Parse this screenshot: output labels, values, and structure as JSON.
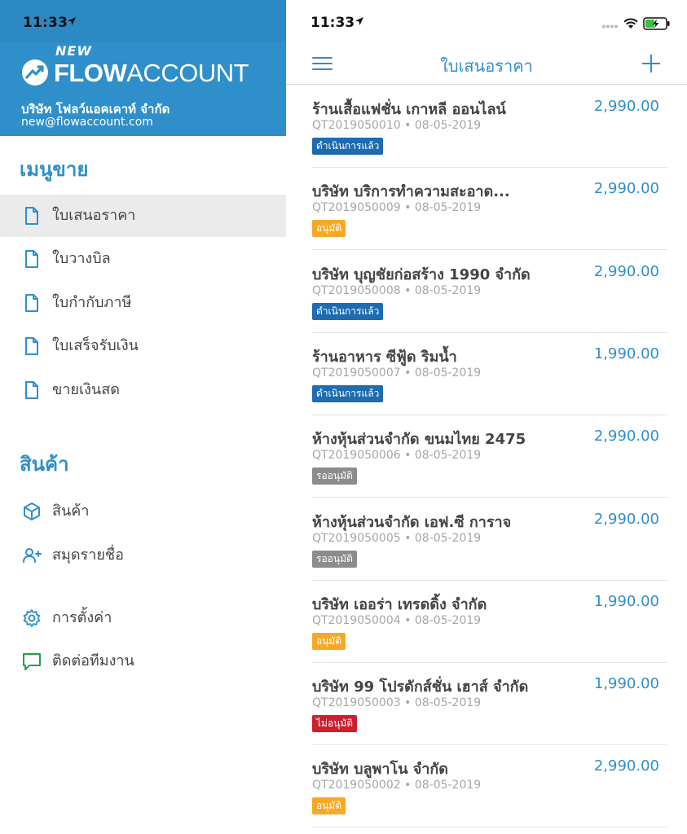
{
  "colors": {
    "brand": "#2f8fca",
    "badge_blue": "#1d6bb0",
    "badge_orange": "#f7a825",
    "badge_gray": "#8c8c8c",
    "badge_red": "#cc1f2f"
  },
  "status_bar": {
    "time_left": "11:33",
    "time_right": "11:33"
  },
  "brand": {
    "logo_new": "NEW",
    "logo_flow": "FLOW",
    "logo_account": "ACCOUNT",
    "company_name": "บริษัท โฟลว์แอคเคาท์ จำกัด",
    "company_email": "new@flowaccount.com"
  },
  "sidebar": {
    "sales_heading": "เมนูขาย",
    "sales_items": [
      {
        "label": "ใบเสนอราคา",
        "icon": "document-icon",
        "active": true
      },
      {
        "label": "ใบวางบิล",
        "icon": "document-icon",
        "active": false
      },
      {
        "label": "ใบกำกับภาษี",
        "icon": "document-icon",
        "active": false
      },
      {
        "label": "ใบเสร็จรับเงิน",
        "icon": "document-icon",
        "active": false
      },
      {
        "label": "ขายเงินสด",
        "icon": "document-icon",
        "active": false
      }
    ],
    "products_heading": "สินค้า",
    "products_items": [
      {
        "label": "สินค้า",
        "icon": "box-icon"
      },
      {
        "label": "สมุดรายชื่อ",
        "icon": "add-contact-icon"
      }
    ],
    "other_items": [
      {
        "label": "การตั้งค่า",
        "icon": "gear-icon"
      },
      {
        "label": "ติดต่อทีมงาน",
        "icon": "chat-icon"
      }
    ]
  },
  "navbar": {
    "title": "ใบเสนอราคา",
    "menu_icon": "hamburger-icon",
    "add_icon": "plus-icon"
  },
  "quotations": [
    {
      "name": "ร้านเสื้อแฟชั่น เกาหลี ออนไลน์",
      "amount": "2,990.00",
      "number": "QT2019050010",
      "date": "08-05-2019",
      "status": "ดำเนินการแล้ว",
      "status_color": "#1d6bb0"
    },
    {
      "name": "บริษัท บริการทำความสะอาด...",
      "amount": "2,990.00",
      "number": "QT2019050009",
      "date": "08-05-2019",
      "status": "อนุมัติ",
      "status_color": "#f7a825"
    },
    {
      "name": "บริษัท บุญชัยก่อสร้าง 1990 จำกัด",
      "amount": "2,990.00",
      "number": "QT2019050008",
      "date": "08-05-2019",
      "status": "ดำเนินการแล้ว",
      "status_color": "#1d6bb0"
    },
    {
      "name": "ร้านอาหาร ซีฟู้ด ริมน้ำ",
      "amount": "1,990.00",
      "number": "QT2019050007",
      "date": "08-05-2019",
      "status": "ดำเนินการแล้ว",
      "status_color": "#1d6bb0"
    },
    {
      "name": "ห้างหุ้นส่วนจำกัด ขนมไทย 2475",
      "amount": "2,990.00",
      "number": "QT2019050006",
      "date": "08-05-2019",
      "status": "รออนุมัติ",
      "status_color": "#8c8c8c"
    },
    {
      "name": "ห้างหุ้นส่วนจำกัด เอฟ.ซี การาจ",
      "amount": "2,990.00",
      "number": "QT2019050005",
      "date": "08-05-2019",
      "status": "รออนุมัติ",
      "status_color": "#8c8c8c"
    },
    {
      "name": "บริษัท เออร่า เทรดดิ้ง จำกัด",
      "amount": "1,990.00",
      "number": "QT2019050004",
      "date": "08-05-2019",
      "status": "อนุมัติ",
      "status_color": "#f7a825"
    },
    {
      "name": "บริษัท 99 โปรดักส์ชั่น เฮาส์ จำกัด",
      "amount": "1,990.00",
      "number": "QT2019050003",
      "date": "08-05-2019",
      "status": "ไม่อนุมัติ",
      "status_color": "#cc1f2f"
    },
    {
      "name": "บริษัท บลูพาโน จำกัด",
      "amount": "2,990.00",
      "number": "QT2019050002",
      "date": "08-05-2019",
      "status": "อนุมัติ",
      "status_color": "#f7a825"
    }
  ]
}
